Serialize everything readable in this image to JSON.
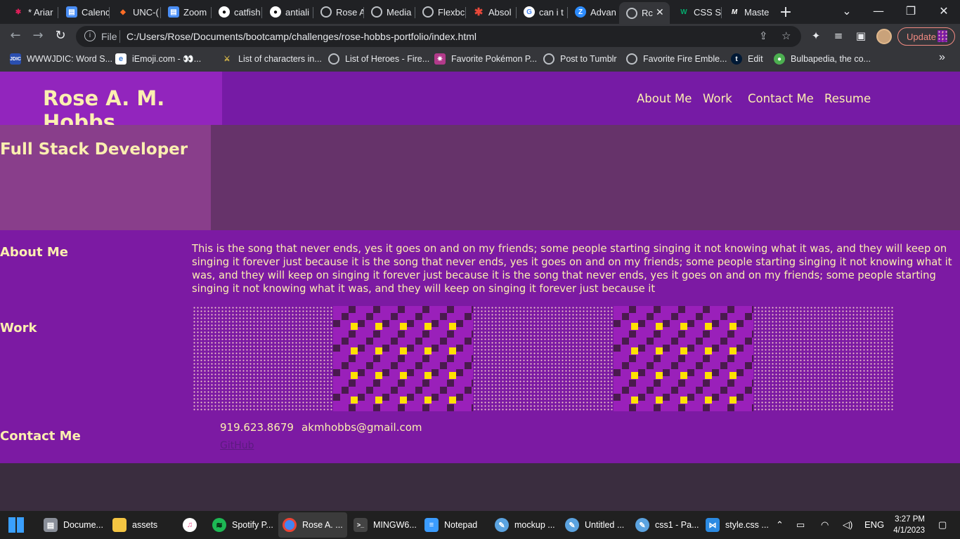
{
  "browser": {
    "tabs": [
      {
        "label": "* Ariar",
        "icon": "slack-icon",
        "color": "#e01e5a"
      },
      {
        "label": "Calenc",
        "icon": "document-icon",
        "color": "#4a8ef5"
      },
      {
        "label": "UNC-(",
        "icon": "gitlab-icon",
        "color": "#fc6d26"
      },
      {
        "label": "Zoom",
        "icon": "document-icon",
        "color": "#4a8ef5"
      },
      {
        "label": "catfish",
        "icon": "github-icon",
        "color": "#ffffff"
      },
      {
        "label": "antiali",
        "icon": "github-icon",
        "color": "#ffffff"
      },
      {
        "label": "Rose A",
        "icon": "globe-icon",
        "color": "#bdc1c6"
      },
      {
        "label": "Media",
        "icon": "globe-icon",
        "color": "#bdc1c6"
      },
      {
        "label": "Flexbc",
        "icon": "globe-icon",
        "color": "#bdc1c6"
      },
      {
        "label": "Absol",
        "icon": "asterisk-icon",
        "color": "#e8483a"
      },
      {
        "label": "can i t",
        "icon": "google-icon",
        "color": "#4285f4"
      },
      {
        "label": "Advan",
        "icon": "zoom-icon",
        "color": "#2d8cff"
      },
      {
        "label": "Rc",
        "icon": "globe-icon",
        "color": "#bdc1c6",
        "active": true
      },
      {
        "label": "CSS S",
        "icon": "w3schools-icon",
        "color": "#04aa6d"
      },
      {
        "label": "Maste",
        "icon": "mdn-icon",
        "color": "#ffffff"
      }
    ],
    "new_tab": "+",
    "address": {
      "scheme_label": "File",
      "url": "C:/Users/Rose/Documents/bootcamp/challenges/rose-hobbs-portfolio/index.html"
    },
    "update_label": "Update",
    "bookmarks": [
      {
        "label": "WWWJDIC: Word S...",
        "icon": "wwwjdic-icon"
      },
      {
        "label": "iEmoji.com - 👀...",
        "icon": "emoji-icon"
      },
      {
        "label": "List of characters in...",
        "icon": "swords-icon"
      },
      {
        "label": "List of Heroes - Fire...",
        "icon": "globe-icon"
      },
      {
        "label": "Favorite Pokémon P...",
        "icon": "pokemon-icon"
      },
      {
        "label": "Post to Tumblr",
        "icon": "globe-icon"
      },
      {
        "label": "Favorite Fire Emble...",
        "icon": "globe-icon"
      },
      {
        "label": "Edit",
        "icon": "tumblr-icon"
      },
      {
        "label": "Bulbapedia, the co...",
        "icon": "bulbapedia-icon"
      }
    ],
    "bookmarks_overflow": "»"
  },
  "page": {
    "brand": "Rose A. M. Hobbs",
    "nav": [
      "About Me",
      "Work",
      "Contact Me",
      "Resume"
    ],
    "hero_title": "Full Stack Developer",
    "about_title": "About Me",
    "about_text": "This is the song that never ends, yes it goes on and on my friends; some people starting singing it not knowing what it was, and they will keep on singing it forever just because it is the song that never ends, yes it goes on and on my friends; some people starting singing it not knowing what it was, and they will keep on singing it forever just because it is the song that never ends, yes it goes on and on my friends; some people starting singing it not knowing what it was, and they will keep on singing it forever just because it",
    "work_title": "Work",
    "work_tiles": [
      "dots",
      "pattern",
      "dots",
      "pattern",
      "dots"
    ],
    "contact_title": "Contact Me",
    "phone": "919.623.8679",
    "email": "akmhobbs@gmail.com",
    "github": "GitHub"
  },
  "taskbar": {
    "items": [
      {
        "label": "Docume...",
        "icon": "docs-icon",
        "color": "#4a8ef5"
      },
      {
        "label": "assets",
        "icon": "folder-icon",
        "color": "#f4c542"
      },
      {
        "label": "",
        "icon": "itunes-icon",
        "color": "#ea4c89"
      },
      {
        "label": "Spotify P...",
        "icon": "spotify-icon",
        "color": "#1db954"
      },
      {
        "label": "Rose A. ...",
        "icon": "chrome-icon",
        "color": "#4285f4",
        "active": true
      },
      {
        "label": "MINGW6...",
        "icon": "terminal-icon",
        "color": "#444444"
      },
      {
        "label": "Notepad",
        "icon": "notepad-icon",
        "color": "#3b9cff"
      },
      {
        "label": "mockup ...",
        "icon": "paint-icon",
        "color": "#5ba3e0"
      },
      {
        "label": "Untitled ...",
        "icon": "paint-icon",
        "color": "#5ba3e0"
      },
      {
        "label": "css1 - Pa...",
        "icon": "paint-icon",
        "color": "#5ba3e0"
      },
      {
        "label": "style.css ...",
        "icon": "vscode-icon",
        "color": "#2b8ae2"
      }
    ],
    "lang": "ENG",
    "time": "3:27 PM",
    "date": "4/1/2023"
  }
}
